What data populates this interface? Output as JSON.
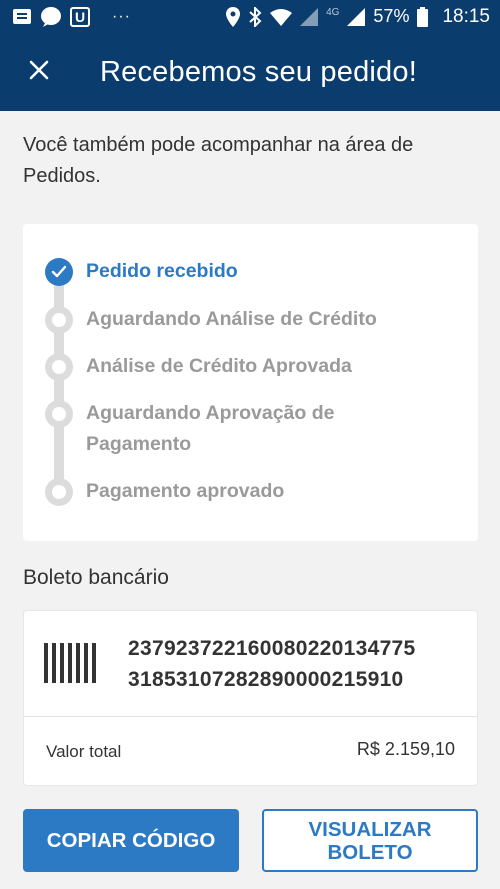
{
  "status_bar": {
    "notification_icons": [
      "message-icon",
      "chat-bubble-icon",
      "u-app-icon"
    ],
    "overflow": "···",
    "network": "4G",
    "battery": "57%",
    "time": "18:15"
  },
  "header": {
    "title": "Recebemos seu pedido!",
    "close_icon": "close-icon"
  },
  "intro_text": "Você também pode acompanhar na área de Pedidos.",
  "order_status": {
    "steps": [
      {
        "label": "Pedido recebido",
        "state": "done"
      },
      {
        "label": "Aguardando Análise de Crédito",
        "state": "pending"
      },
      {
        "label": "Análise de Crédito Aprovada",
        "state": "pending"
      },
      {
        "label": "Aguardando Aprovação de Pagamento",
        "state": "pending"
      },
      {
        "label": "Pagamento aprovado",
        "state": "pending"
      }
    ]
  },
  "boleto": {
    "section_title": "Boleto bancário",
    "barcode_line_1": "23792372216008022013477​5",
    "barcode_line_2": "318531072828900002159​10",
    "total_label": "Valor total",
    "total_value": "R$ 2.159,10"
  },
  "actions": {
    "copy_label": "COPIAR CÓDIGO",
    "view_label_1": "VISUALIZAR",
    "view_label_2": "BOLETO"
  },
  "colors": {
    "header_bg": "#0b3c6e",
    "accent": "#2c7ac4",
    "background": "#f2f2f2"
  }
}
